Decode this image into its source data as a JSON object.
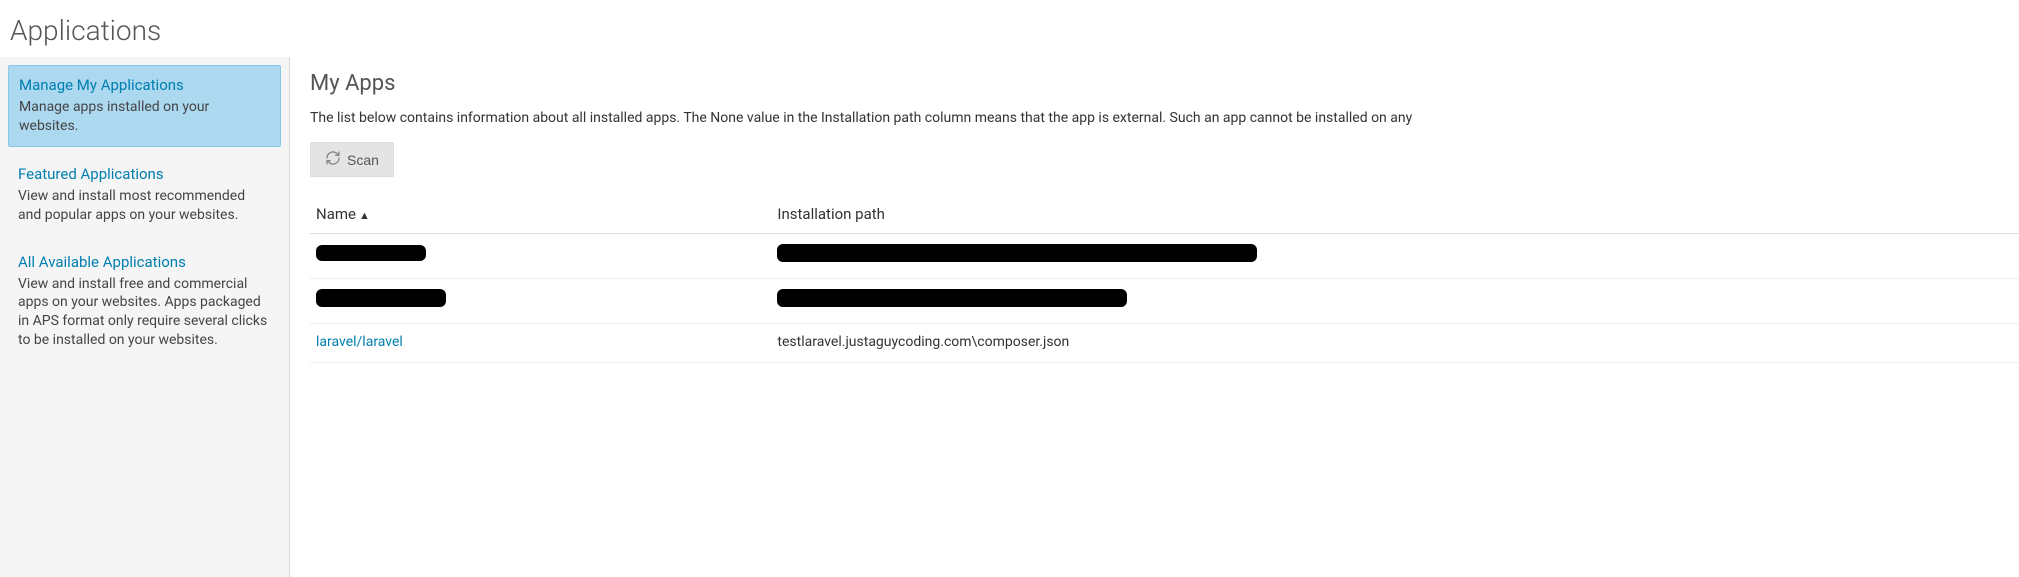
{
  "page_title": "Applications",
  "sidebar": {
    "items": [
      {
        "title": "Manage My Applications",
        "desc": "Manage apps installed on your websites."
      },
      {
        "title": "Featured Applications",
        "desc": "View and install most recommended and popular apps on your websites."
      },
      {
        "title": "All Available Applications",
        "desc": "View and install free and commercial apps on your websites. Apps packaged in APS format only require several clicks to be installed on your websites."
      }
    ]
  },
  "main": {
    "heading": "My Apps",
    "description": "The list below contains information about all installed apps. The None value in the Installation path column means that the app is external. Such an app cannot be installed on any ",
    "scan_label": "Scan",
    "columns": {
      "name": "Name",
      "path": "Installation path"
    },
    "rows": [
      {
        "name": "",
        "path": "",
        "redacted": true
      },
      {
        "name": "",
        "path": "",
        "redacted": true
      },
      {
        "name": "laravel/laravel",
        "path": "testlaravel.justaguycoding.com\\composer.json",
        "redacted": false
      }
    ]
  }
}
